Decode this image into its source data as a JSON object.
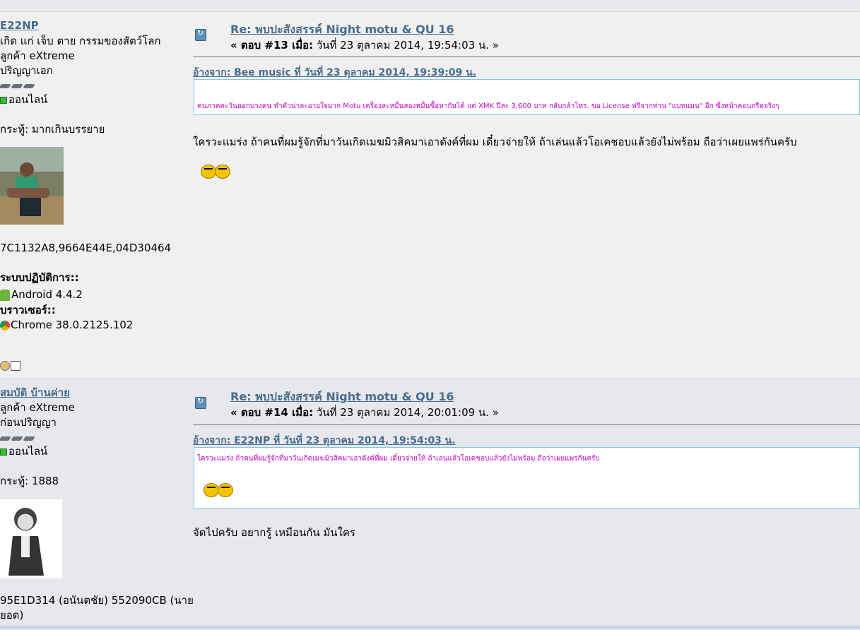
{
  "posts": [
    {
      "author": {
        "name": "E22NP",
        "title": "เกิด แก่ เจ็บ ตาย กรรมของสัตว์โลก",
        "group": "ลูกค้า eXtreme",
        "rank": "ปริญญาเอก",
        "status": "ออนไลน์",
        "post_count": "กระทู้: มากเกินบรรยาย",
        "serial": "7C1132A8,9664E44E,04D30464",
        "os_label": "ระบบปฏิบัติการ::",
        "os_value": "Android 4.4.2",
        "browser_label": "บราวเซอร์::",
        "browser_value": "Chrome 38.0.2125.102"
      },
      "subject": "Re: พบปะสังสรรค์ Night motu & QU 16",
      "meta_prefix": "« ตอบ #13 เมื่อ:",
      "meta_date": "วันที่ 23 ตุลาคม 2014, 19:54:03 น. »",
      "quote_header": "อ้างจาก: Bee music ที่ วันที่ 23 ตุลาคม  2014, 19:39:09 น.",
      "quote_text": "คนภาคตะวันออกบางคน ทำตัวน่าละอายใจมาก Motu เครื่องละหมื่นสองหมื่นซื้อหากันได้ แต่ XMK ปีละ 3,600 บาท กลับกล้าโทร. ขอ License ฟรีจากท่าน \"แบทแมน\" อีก ซึ่งหน้าคอนกรีตจริงๆ",
      "body": "ใครวะแมร่ง ถ้าคนที่ผมรู้จักที่มาวันเกิดเมฆมิวสิคมาเอาดังค์ที่ผม เดี๋ยวจ่ายให้ ถ้าเล่นแล้วโอเคชอบแล้วยังไม่พร้อม ถือว่าเผยแพร่กันครับ"
    },
    {
      "author": {
        "name": "สมบัติ บ้านค่าย",
        "group": "ลูกค้า eXtreme",
        "rank": "ก่อนปริญญา",
        "status": "ออนไลน์",
        "post_count": "กระทู้: 1888",
        "serial_line1": "95E1D314 (อนันตชัย) 552090CB (นาย",
        "serial_line2": "ยอด)"
      },
      "subject": "Re: พบปะสังสรรค์ Night motu & QU 16",
      "meta_prefix": "« ตอบ #14 เมื่อ:",
      "meta_date": "วันที่ 23 ตุลาคม 2014, 20:01:09 น. »",
      "quote_header": "อ้างจาก: E22NP ที่ วันที่ 23 ตุลาคม  2014, 19:54:03 น.",
      "quote_text": "ใครวะแมร่ง ถ้าคนที่ผมรู้จักที่มาวันเกิดเมฆมิวสิคมาเอาดังค์ที่ผม เดี๋ยวจ่ายให้ ถ้าเล่นแล้วโอเคชอบแล้วยังไม่พร้อม ถือว่าเผยแพร่กันครับ",
      "body": "จัดไปครับ อยากรู้ เหมือนกัน มันใคร"
    }
  ]
}
